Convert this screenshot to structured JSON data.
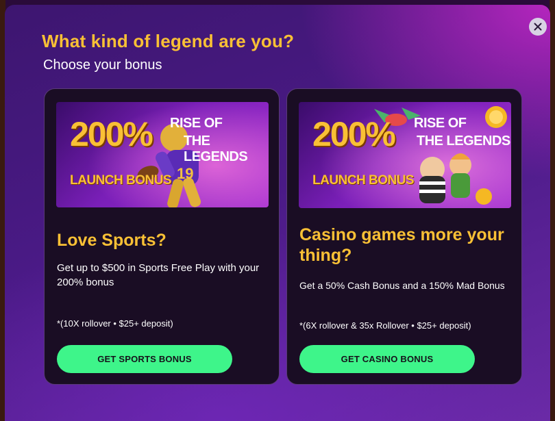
{
  "modal": {
    "headline": "What kind of legend are you?",
    "subheadline": "Choose your bonus"
  },
  "colors": {
    "accent_gold": "#f9c035",
    "cta_green": "#3ef58a",
    "card_bg": "#1a0d24"
  },
  "cards": [
    {
      "id": "sports",
      "banner": {
        "percent": "200%",
        "launch": "LAUNCH BONUS",
        "rise_of": "RISE OF",
        "the_legends": "THE LEGENDS",
        "icon": "football-player-illustration"
      },
      "title": "Love Sports?",
      "description": "Get up to $500 in Sports Free Play with your 200% bonus",
      "terms": "*(10X rollover • $25+ deposit)",
      "cta": "GET SPORTS BONUS"
    },
    {
      "id": "casino",
      "banner": {
        "percent": "200%",
        "launch": "LAUNCH BONUS",
        "rise_of": "RISE OF",
        "the_legends": "THE LEGENDS",
        "icon": "casino-characters-illustration"
      },
      "title": "Casino games more your thing?",
      "description": "Get a 50% Cash Bonus and a 150% Mad Bonus",
      "terms": "*(6X rollover & 35x Rollover • $25+ deposit)",
      "cta": "GET CASINO BONUS"
    }
  ],
  "close_icon": "close-icon"
}
